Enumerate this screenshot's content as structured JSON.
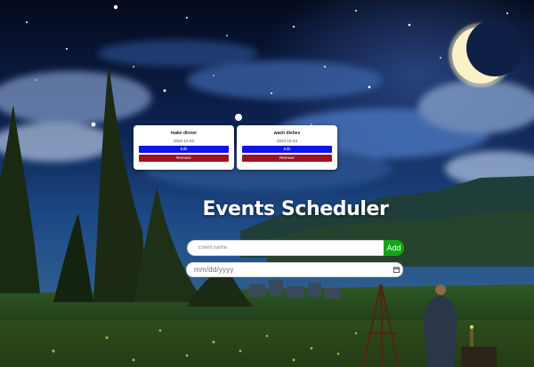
{
  "app": {
    "title": "Events Scheduler"
  },
  "events": [
    {
      "name": "make dinner",
      "date": "2022-12-22",
      "edit_label": "Edit",
      "remove_label": "Remove"
    },
    {
      "name": "wash dishes",
      "date": "2022-12-24",
      "edit_label": "Edit",
      "remove_label": "Remove"
    }
  ],
  "form": {
    "name_placeholder": "Event name",
    "name_value": "",
    "add_label": "Add",
    "date_placeholder": "mm/dd/yyyy"
  },
  "icons": {
    "date_picker": "calendar-icon"
  },
  "colors": {
    "edit_button": "#0c16e8",
    "remove_button": "#a2111a",
    "add_button": "#16a21a",
    "title_text": "#ffffff"
  }
}
